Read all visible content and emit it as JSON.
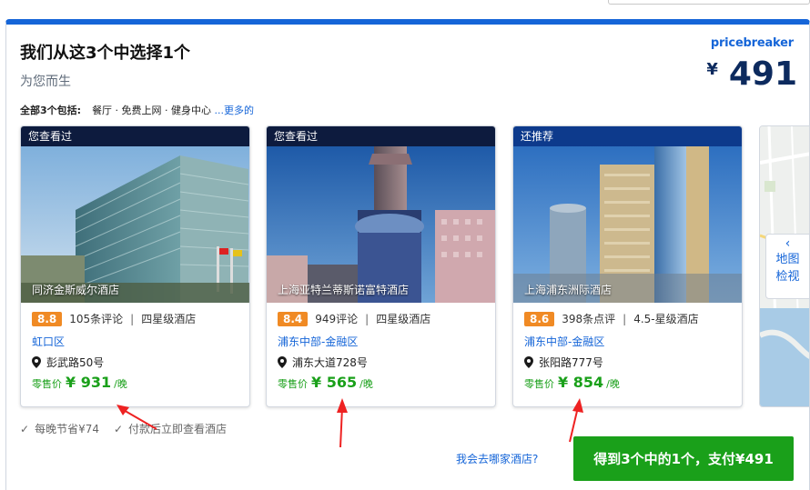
{
  "header": {
    "headline": "我们从这3个中选择1个",
    "subheadline": "为您而生",
    "includes_label": "全部3个包括:",
    "amenities": "餐厅 · 免费上网 · 健身中心",
    "more_link": "...更多的"
  },
  "pricebreaker": {
    "logo_text": "pricebreaker",
    "currency": "¥",
    "price": "491"
  },
  "cards": [
    {
      "tag": "您查看过",
      "tag_color": "#0d1b3e",
      "name": "同济金斯威尔酒店",
      "score": "8.8",
      "reviews": "105条评论",
      "stars": "四星级酒店",
      "district": "虹口区",
      "address": "彭武路50号",
      "price_label": "零售价",
      "price": "¥ 931",
      "per_night": "/晚"
    },
    {
      "tag": "您查看过",
      "tag_color": "#0d1b3e",
      "name": "上海亚特兰蒂斯诺富特酒店",
      "score": "8.4",
      "reviews": "949评论",
      "stars": "四星级酒店",
      "district": "浦东中部-金融区",
      "address": "浦东大道728号",
      "price_label": "零售价",
      "price": "¥ 565",
      "per_night": "/晚"
    },
    {
      "tag": "还推荐",
      "tag_color": "#0d3a8c",
      "name": "上海浦东洲际酒店",
      "score": "8.6",
      "reviews": "398条点评",
      "stars": "4.5-星级酒店",
      "district": "浦东中部-金融区",
      "address": "张阳路777号",
      "price_label": "零售价",
      "price": "¥ 854",
      "per_night": "/晚"
    }
  ],
  "map": {
    "label_line1": "地图",
    "label_line2": "检视"
  },
  "benefits": [
    "每晚节省¥74",
    "付款后立即查看酒店"
  ],
  "footer": {
    "which_hotel_link": "我会去哪家酒店?",
    "cta_label": "得到3个中的1个，支付¥491"
  },
  "colors": {
    "accent_blue": "#1565d8",
    "price_green": "#1aa01a",
    "score_orange": "#f08a24",
    "annotation_red": "#ee2222"
  }
}
